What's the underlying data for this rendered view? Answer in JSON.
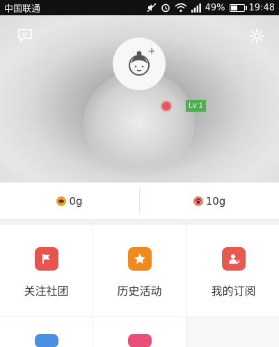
{
  "status_bar": {
    "carrier": "中国联通",
    "battery_percent": "49%",
    "battery_level": 0.49,
    "time": "19:48",
    "icons": [
      "mute-icon",
      "alarm-icon",
      "wifi-icon",
      "signal-icon",
      "battery-icon"
    ]
  },
  "header": {
    "level": "Lv 1",
    "icons": {
      "message": "message-icon",
      "settings": "gear-icon",
      "avatar": "avatar-icon"
    }
  },
  "stats": [
    {
      "value": "0g",
      "icon": "coin-icon",
      "color": "#e9a13c"
    },
    {
      "value": "10g",
      "icon": "paw-icon",
      "color": "#f27d73"
    }
  ],
  "menu": [
    {
      "label": "关注社团",
      "icon": "flag-icon",
      "color": "#e8544e"
    },
    {
      "label": "历史活动",
      "icon": "star-icon",
      "color": "#f08a1e"
    },
    {
      "label": "我的订阅",
      "icon": "subscribe-icon",
      "color": "#e85a4f"
    }
  ],
  "partial_tiles": [
    {
      "icon": "tile-icon",
      "color": "#4a90e2"
    },
    {
      "icon": "tile-icon",
      "color": "#e8507a"
    }
  ]
}
